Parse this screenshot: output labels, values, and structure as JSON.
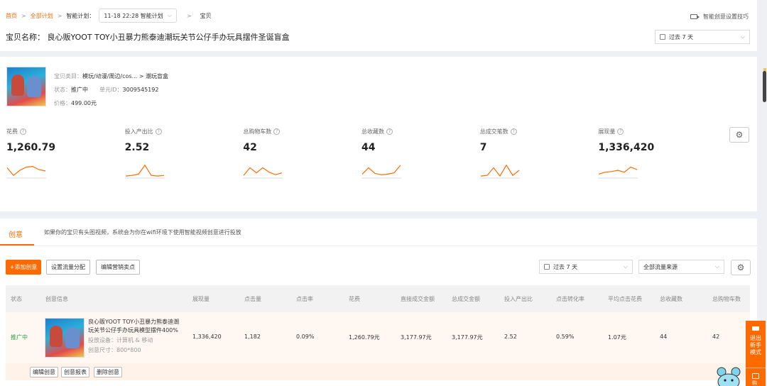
{
  "breadcrumb": {
    "home": "首页",
    "all_plans": "全部计划",
    "smart_plan_label": "智能计划：",
    "smart_plan_value": "11-18 22:28 智能计划",
    "current": "宝贝"
  },
  "header": {
    "tip": "智能创意设置技巧",
    "product_name_label": "宝贝名称：",
    "product_name": "良心贩YOOT TOY小丑暴力熊泰迪潮玩关节公仔手办玩具摆件圣诞盲盒",
    "date_range": "过去 7 天"
  },
  "product": {
    "category_label": "宝贝类目：",
    "category": "模玩/动漫/周边/cos... > 潮玩盲盒",
    "status_label": "状态：",
    "status": "推广中",
    "unit_label": "单元ID：",
    "unit_id": "3009545192",
    "price_label": "价格：",
    "price": "499.00元"
  },
  "metrics": [
    {
      "label": "花费",
      "value": "1,260.79",
      "trend": [
        0.3,
        0.9,
        0.5,
        0.25,
        0.2,
        0.45,
        0.55
      ]
    },
    {
      "label": "投入产出比",
      "value": "2.52",
      "trend": [
        0.95,
        0.9,
        0.8,
        0.1,
        0.9,
        0.95,
        0.9
      ]
    },
    {
      "label": "总购物车数",
      "value": "42",
      "trend": [
        0.9,
        0.3,
        0.7,
        0.3,
        0.65,
        0.85,
        0.7
      ]
    },
    {
      "label": "总收藏数",
      "value": "44",
      "trend": [
        0.8,
        0.3,
        0.75,
        0.85,
        0.8,
        0.7,
        0.1
      ]
    },
    {
      "label": "总成交笔数",
      "value": "7",
      "trend": [
        0.95,
        0.9,
        0.3,
        0.95,
        0.1,
        0.9,
        0.5
      ]
    },
    {
      "label": "展现量",
      "value": "1,336,420",
      "trend": [
        0.8,
        0.65,
        0.6,
        0.5,
        0.65,
        0.25,
        0.45
      ]
    }
  ],
  "creative": {
    "tab": "创意",
    "note": "如果你的宝贝有头图视频，系统会为你在wifi环境下使用智能视频创意进行投放",
    "add_button": "+添加创意",
    "traffic_button": "设置流量分配",
    "selling_button": "编辑营销卖点",
    "date_range": "过去 7 天",
    "source": "全部流量来源"
  },
  "table": {
    "headers": [
      "状态",
      "创意信息",
      "展现量",
      "点击量",
      "点击率",
      "花费",
      "直接成交金额",
      "总成交金额",
      "投入产出比",
      "点击转化率",
      "平均点击花费",
      "总收藏数",
      "总购物车数"
    ],
    "row": {
      "status": "推广中",
      "title": "良心贩YOOT TOY小丑暴力熊泰迪潮玩关节公仔手办玩具模型摆件400%",
      "device_label": "投放设备：",
      "device": "计算机 & 移动",
      "size_label": "创意尺寸：",
      "size": "800*800",
      "impressions": "1,336,420",
      "clicks": "1,182",
      "ctr": "0.09%",
      "spend": "1,260.79元",
      "direct_gmv": "3,177.97元",
      "total_gmv": "3,177.97元",
      "roi": "2.52",
      "cvr": "0.59%",
      "cpc": "1.07元",
      "favorites": "44",
      "carts": "42"
    },
    "actions": [
      "编辑创意",
      "创意报表",
      "删除创意"
    ]
  },
  "floating": {
    "exit_label": "退出新手模式",
    "cart_label": "购"
  },
  "colors": {
    "accent": "#ff6a00",
    "row_bg": "#fff8f2"
  }
}
